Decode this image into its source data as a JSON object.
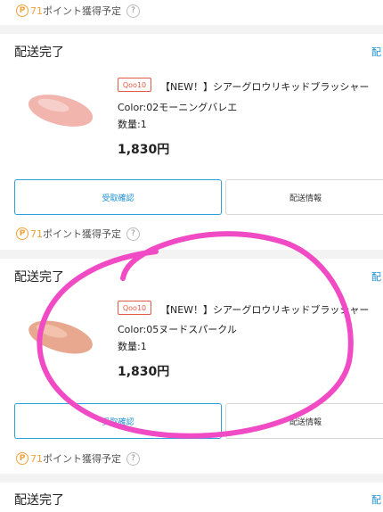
{
  "points_label": "ポイント獲得予定",
  "help_glyph": "?",
  "p_glyph": "P",
  "colors": {
    "accent": "#1c8ed1",
    "points": "#f0a23a",
    "badge": "#e25b45",
    "annotation": "#f04ac4"
  },
  "top_points": {
    "amount": "71"
  },
  "orders": [
    {
      "status": "配送完了",
      "side_link": "配",
      "badge": "Qoo10",
      "name": "【NEW！】シアーグロウリキッドブラッシャー",
      "variant": "Color:02モーニングバレエ",
      "quantity": "数量:1",
      "price": "1,830円",
      "buttons": {
        "confirm": "受取確認",
        "delivery": "配送情報"
      },
      "points": {
        "amount": "71"
      }
    },
    {
      "status": "配送完了",
      "side_link": "配",
      "badge": "Qoo10",
      "name": "【NEW！】シアーグロウリキッドブラッシャー",
      "variant": "Color:05ヌードスパークル",
      "quantity": "数量:1",
      "price": "1,830円",
      "buttons": {
        "confirm": "受取確認",
        "delivery": "配送情報"
      },
      "points": {
        "amount": "71"
      }
    },
    {
      "status": "配送完了",
      "side_link": "配"
    }
  ]
}
